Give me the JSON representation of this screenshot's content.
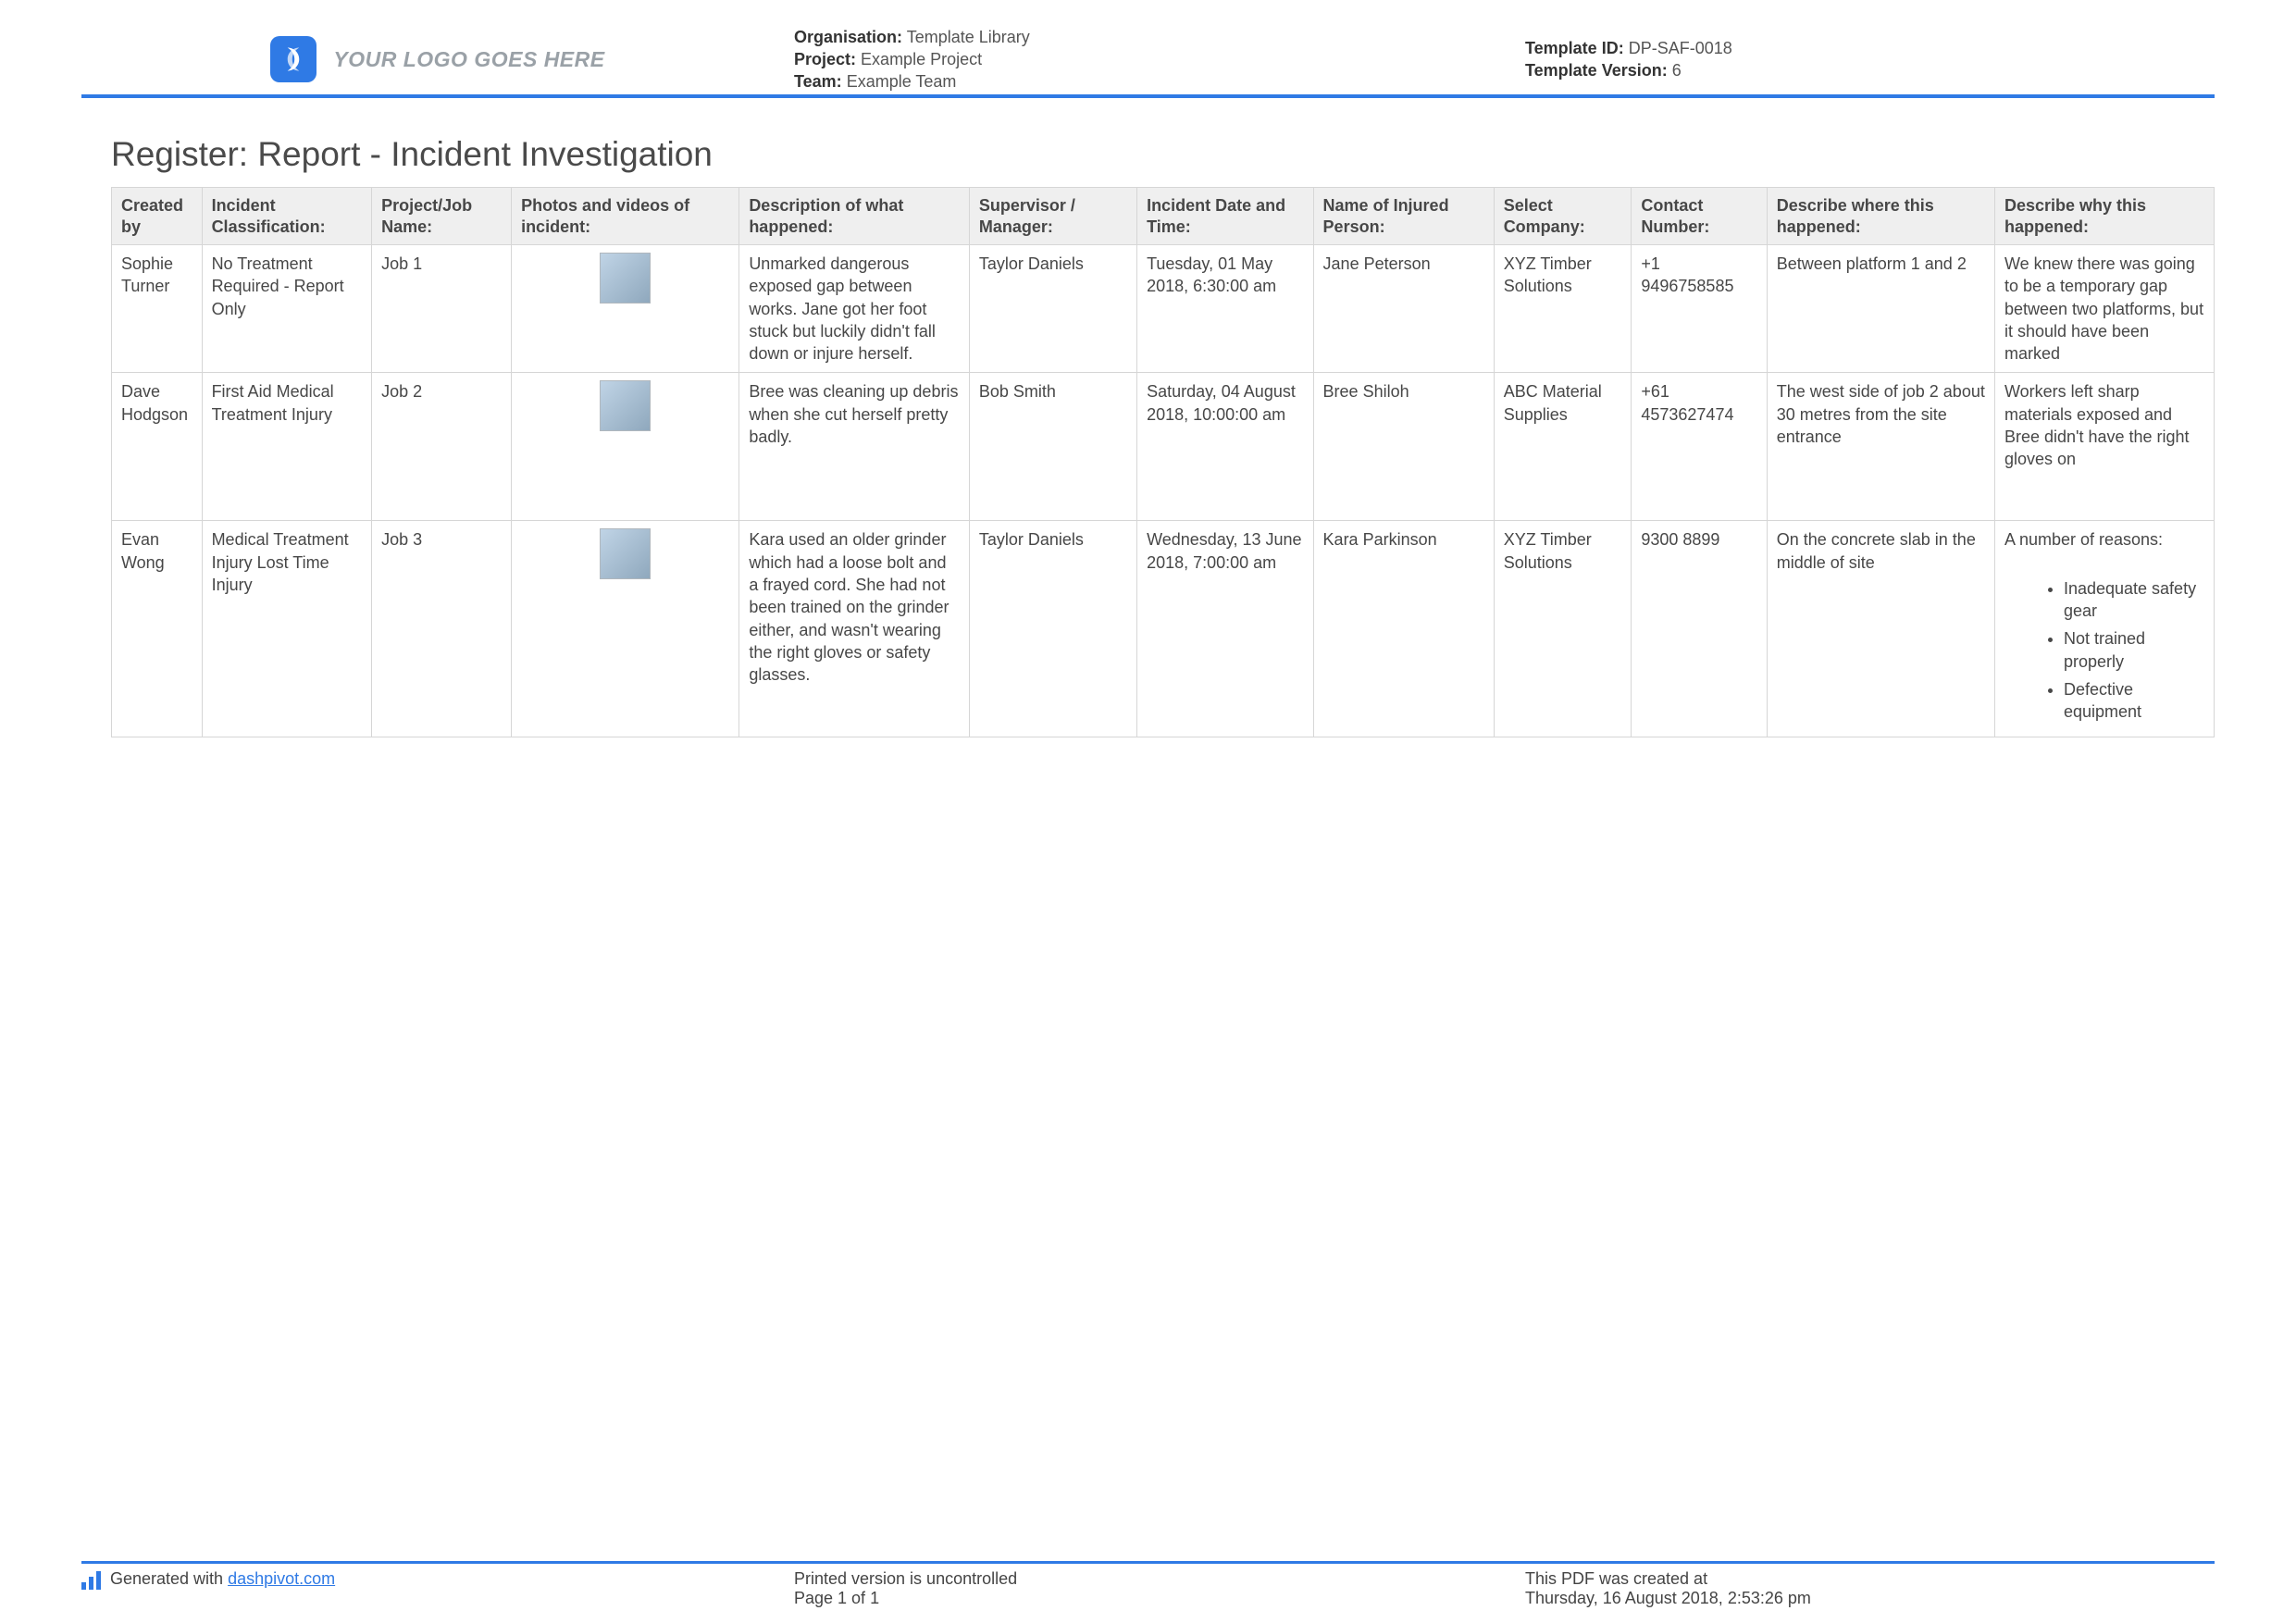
{
  "header": {
    "logo_text": "YOUR LOGO GOES HERE",
    "organisation_label": "Organisation:",
    "organisation_value": "Template Library",
    "project_label": "Project:",
    "project_value": "Example Project",
    "team_label": "Team:",
    "team_value": "Example Team",
    "template_id_label": "Template ID:",
    "template_id_value": "DP-SAF-0018",
    "template_version_label": "Template Version:",
    "template_version_value": "6"
  },
  "title": "Register: Report - Incident Investigation",
  "columns": [
    "Created by",
    "Incident Classification:",
    "Project/Job Name:",
    "Photos and videos of incident:",
    "Description of what happened:",
    "Supervisor / Manager:",
    "Incident Date and Time:",
    "Name of Injured Person:",
    "Select Company:",
    "Contact Number:",
    "Describe where this happened:",
    "Describe why this happened:"
  ],
  "rows": [
    {
      "created_by": "Sophie Turner",
      "classification": "No Treatment Required - Report Only",
      "job": "Job 1",
      "description": "Unmarked dangerous exposed gap between works. Jane got her foot stuck but luckily didn't fall down or injure herself.",
      "supervisor": "Taylor Daniels",
      "datetime": "Tuesday, 01 May 2018, 6:30:00 am",
      "injured": "Jane Peterson",
      "company": "XYZ Timber Solutions",
      "contact": "+1 9496758585",
      "where": "Between platform 1 and 2",
      "why_text": "We knew there was going to be a temporary gap between two platforms, but it should have been marked",
      "why_bullets": []
    },
    {
      "created_by": "Dave Hodgson",
      "classification": "First Aid   Medical Treatment Injury",
      "job": "Job 2",
      "description": "Bree was cleaning up debris when she cut herself pretty badly.",
      "supervisor": "Bob Smith",
      "datetime": "Saturday, 04 August 2018, 10:00:00 am",
      "injured": "Bree Shiloh",
      "company": "ABC Material Supplies",
      "contact": "+61 4573627474",
      "where": "The west side of job 2 about 30 metres from the site entrance",
      "why_text": "Workers left sharp materials exposed and Bree didn't have the right gloves on",
      "why_bullets": []
    },
    {
      "created_by": "Evan Wong",
      "classification": "Medical Treatment Injury   Lost Time Injury",
      "job": "Job 3",
      "description": "Kara used an older grinder which had a loose bolt and a frayed cord. She had not been trained on the grinder either, and wasn't wearing the right gloves or safety glasses.",
      "supervisor": "Taylor Daniels",
      "datetime": "Wednesday, 13 June 2018, 7:00:00 am",
      "injured": "Kara Parkinson",
      "company": "XYZ Timber Solutions",
      "contact": "9300 8899",
      "where": "On the concrete slab in the middle of site",
      "why_text": "A number of reasons:",
      "why_bullets": [
        "Inadequate safety gear",
        "Not trained properly",
        "Defective equipment"
      ]
    }
  ],
  "footer": {
    "generated_prefix": "Generated with ",
    "generated_link_text": "dashpivot.com",
    "printed_line": "Printed version is uncontrolled",
    "page_line": "Page 1 of 1",
    "created_line": "This PDF was created at",
    "created_time": "Thursday, 16 August 2018, 2:53:26 pm"
  }
}
